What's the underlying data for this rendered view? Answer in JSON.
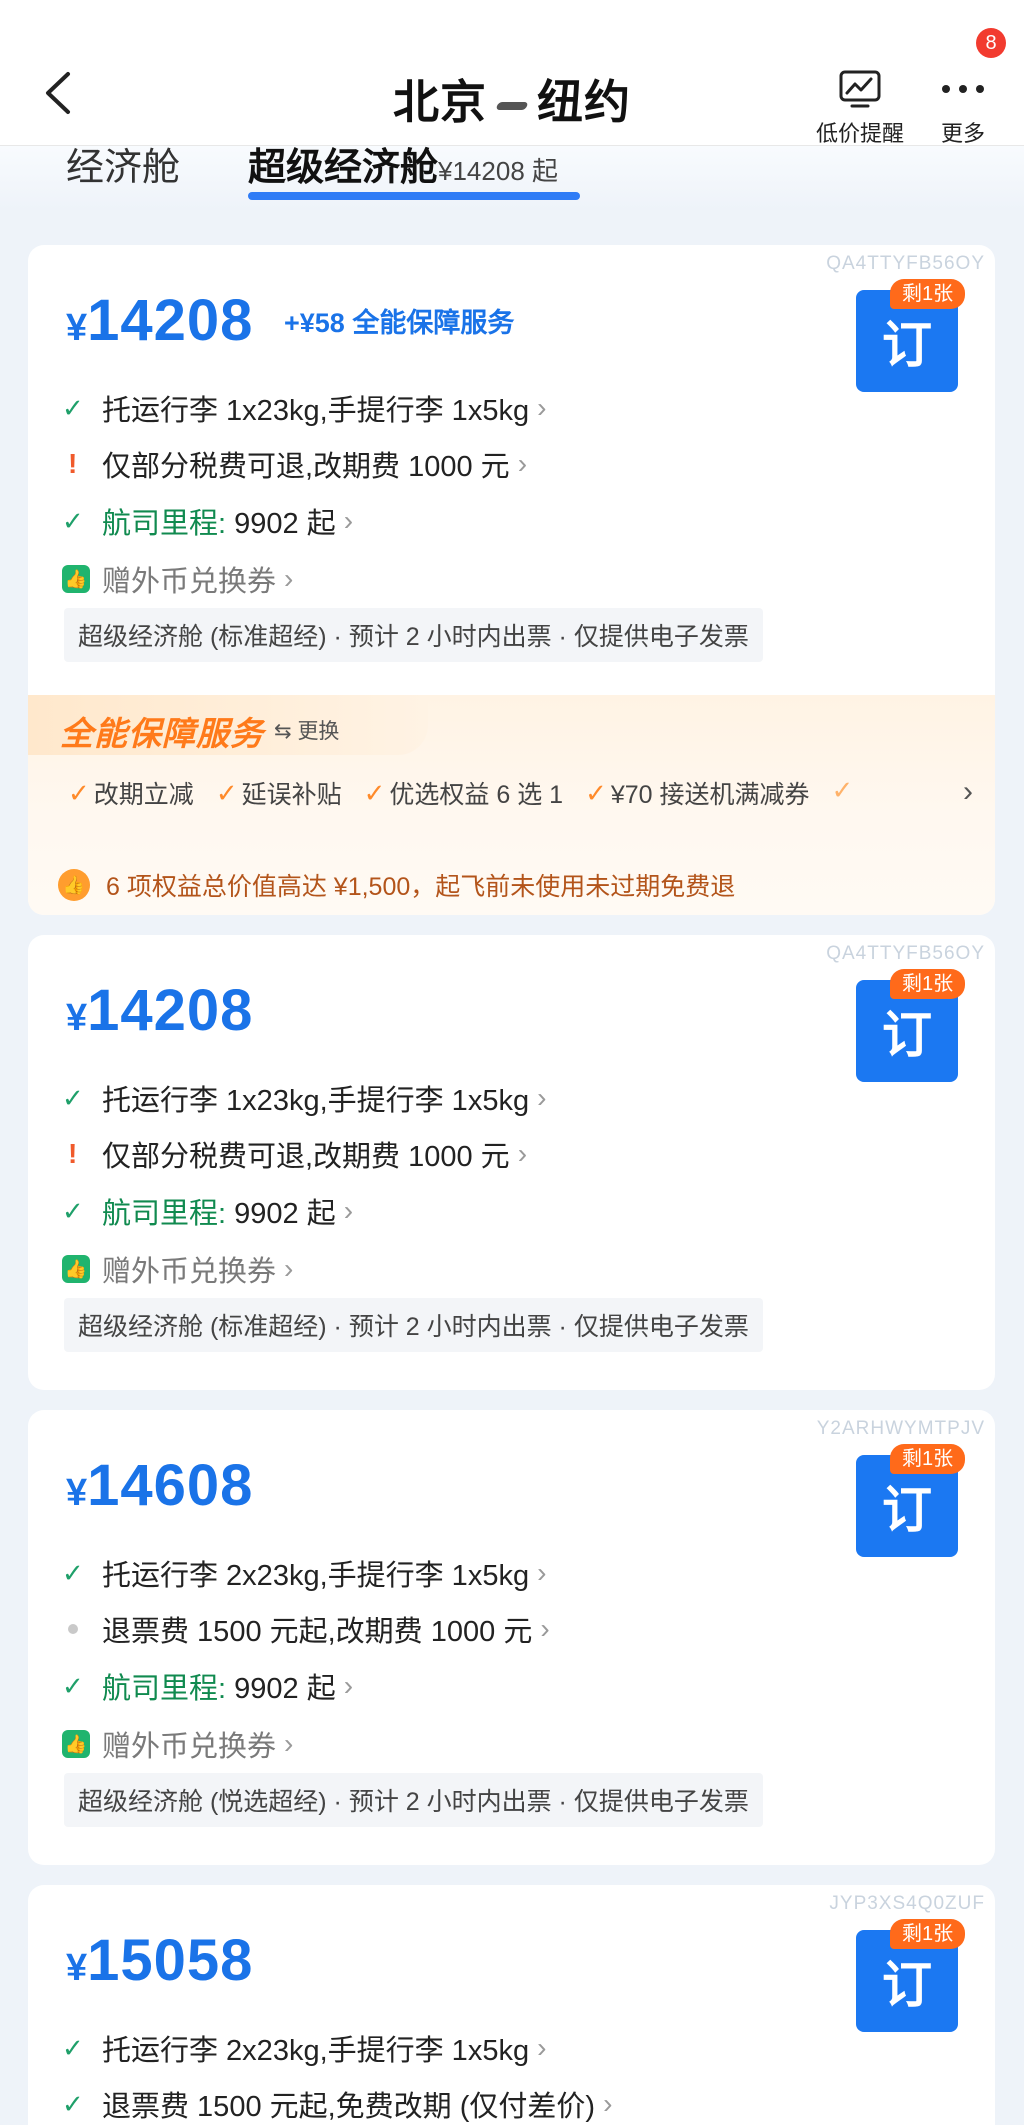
{
  "header": {
    "origin": "北京",
    "destination": "纽约",
    "alert_label": "低价提醒",
    "more_label": "更多",
    "badge_count": "8"
  },
  "tabs": {
    "economy": "经济舱",
    "super_economy": "超级经济舱",
    "super_from": "¥14208 起"
  },
  "cards": [
    {
      "code": "QA4TTYFB56OY",
      "currency": "¥",
      "price": "14208",
      "addon": "+¥58 全能保障服务",
      "remain": "剩1张",
      "book": "订",
      "baggage": "托运行李 1x23kg,手提行李 1x5kg",
      "refund": "仅部分税费可退,改期费 1000 元",
      "miles_label": "航司里程:",
      "miles_value": "9902 起",
      "gift": "赠外币兑换券",
      "tag": "超级经济舱 (标准超经) · 预计 2 小时内出票 · 仅提供电子发票",
      "service": {
        "title": "全能保障服务",
        "change": "更换",
        "items": [
          "改期立减",
          "延误补贴",
          "优选权益 6 选 1",
          "¥70 接送机满减券"
        ],
        "note": "6 项权益总价值高达 ¥1,500，起飞前未使用未过期免费退"
      }
    },
    {
      "code": "QA4TTYFB56OY",
      "currency": "¥",
      "price": "14208",
      "remain": "剩1张",
      "book": "订",
      "baggage": "托运行李 1x23kg,手提行李 1x5kg",
      "refund": "仅部分税费可退,改期费 1000 元",
      "miles_label": "航司里程:",
      "miles_value": "9902 起",
      "gift": "赠外币兑换券",
      "tag": "超级经济舱 (标准超经) · 预计 2 小时内出票 · 仅提供电子发票"
    },
    {
      "code": "Y2ARHWYMTPJV",
      "currency": "¥",
      "price": "14608",
      "remain": "剩1张",
      "book": "订",
      "baggage": "托运行李 2x23kg,手提行李 1x5kg",
      "refund": "退票费 1500 元起,改期费 1000 元",
      "miles_label": "航司里程:",
      "miles_value": "9902 起",
      "gift": "赠外币兑换券",
      "tag": "超级经济舱 (悦选超经) · 预计 2 小时内出票 · 仅提供电子发票"
    },
    {
      "code": "JYP3XS4Q0ZUF",
      "currency": "¥",
      "price": "15058",
      "remain": "剩1张",
      "book": "订",
      "baggage": "托运行李 2x23kg,手提行李 1x5kg",
      "refund": "退票费 1500 元起,免费改期 (仅付差价)"
    }
  ],
  "colors": {
    "accent_blue": "#1a73e8",
    "book_blue": "#1b78f2",
    "check_green": "#1fa06a",
    "warn_orange": "#f05a2b",
    "service_orange": "#ff7a1a",
    "badge_red": "#f23b2f"
  },
  "icons": {
    "back": "chevron-left-icon",
    "alert": "price-alert-icon",
    "more": "more-dots-icon",
    "check": "check-icon",
    "warn": "exclamation-icon",
    "gift": "thumbs-up-icon"
  }
}
